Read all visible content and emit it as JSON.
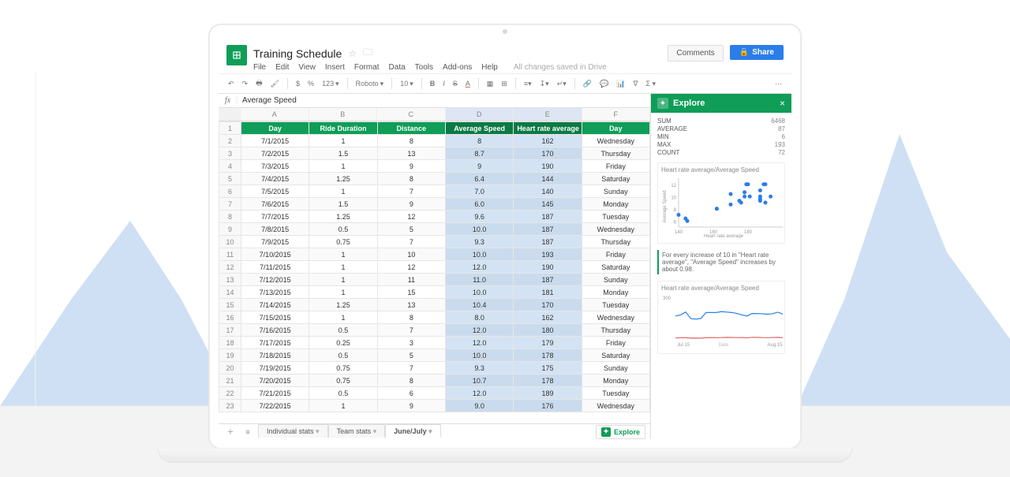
{
  "doc": {
    "title": "Training Schedule",
    "saved_msg": "All changes saved in Drive",
    "comments_label": "Comments",
    "share_label": "Share"
  },
  "menus": [
    "File",
    "Edit",
    "View",
    "Insert",
    "Format",
    "Data",
    "Tools",
    "Add-ons",
    "Help"
  ],
  "toolbar": {
    "zoom": "123",
    "font": "Roboto",
    "size": "10"
  },
  "fx": {
    "value": "Average Speed"
  },
  "columns_letters": [
    "A",
    "B",
    "C",
    "D",
    "E",
    "F"
  ],
  "columns": [
    "Day",
    "Ride Duration",
    "Distance",
    "Average Speed",
    "Heart rate average",
    "Day"
  ],
  "selected_cols": [
    3,
    4
  ],
  "rows": [
    [
      "7/1/2015",
      "1",
      "8",
      "8",
      "162",
      "Wednesday"
    ],
    [
      "7/2/2015",
      "1.5",
      "13",
      "8.7",
      "170",
      "Thursday"
    ],
    [
      "7/3/2015",
      "1",
      "9",
      "9",
      "190",
      "Friday"
    ],
    [
      "7/4/2015",
      "1.25",
      "8",
      "6.4",
      "144",
      "Saturday"
    ],
    [
      "7/5/2015",
      "1",
      "7",
      "7.0",
      "140",
      "Sunday"
    ],
    [
      "7/6/2015",
      "1.5",
      "9",
      "6.0",
      "145",
      "Monday"
    ],
    [
      "7/7/2015",
      "1.25",
      "12",
      "9.6",
      "187",
      "Tuesday"
    ],
    [
      "7/8/2015",
      "0.5",
      "5",
      "10.0",
      "187",
      "Wednesday"
    ],
    [
      "7/9/2015",
      "0.75",
      "7",
      "9.3",
      "187",
      "Thursday"
    ],
    [
      "7/10/2015",
      "1",
      "10",
      "10.0",
      "193",
      "Friday"
    ],
    [
      "7/11/2015",
      "1",
      "12",
      "12.0",
      "190",
      "Saturday"
    ],
    [
      "7/12/2015",
      "1",
      "11",
      "11.0",
      "187",
      "Sunday"
    ],
    [
      "7/13/2015",
      "1",
      "15",
      "10.0",
      "181",
      "Monday"
    ],
    [
      "7/14/2015",
      "1.25",
      "13",
      "10.4",
      "170",
      "Tuesday"
    ],
    [
      "7/15/2015",
      "1",
      "8",
      "8.0",
      "162",
      "Wednesday"
    ],
    [
      "7/16/2015",
      "0.5",
      "7",
      "12.0",
      "180",
      "Thursday"
    ],
    [
      "7/17/2015",
      "0.25",
      "3",
      "12.0",
      "179",
      "Friday"
    ],
    [
      "7/18/2015",
      "0.5",
      "5",
      "10.0",
      "178",
      "Saturday"
    ],
    [
      "7/19/2015",
      "0.75",
      "7",
      "9.3",
      "175",
      "Sunday"
    ],
    [
      "7/20/2015",
      "0.75",
      "8",
      "10.7",
      "178",
      "Monday"
    ],
    [
      "7/21/2015",
      "0.5",
      "6",
      "12.0",
      "189",
      "Tuesday"
    ],
    [
      "7/22/2015",
      "1",
      "9",
      "9.0",
      "176",
      "Wednesday"
    ]
  ],
  "sheet_tabs": {
    "items": [
      "Individual stats",
      "Team stats",
      "June/July"
    ],
    "active": 2,
    "explore_label": "Explore"
  },
  "explore": {
    "title": "Explore",
    "stats": [
      {
        "k": "SUM",
        "v": "6468"
      },
      {
        "k": "AVERAGE",
        "v": "87"
      },
      {
        "k": "MIN",
        "v": "6"
      },
      {
        "k": "MAX",
        "v": "193"
      },
      {
        "k": "COUNT",
        "v": "72"
      }
    ],
    "scatter": {
      "title": "Heart rate average/Average Speed",
      "xlabel": "Heart rate average",
      "ylabel": "Average Speed"
    },
    "insight": "For every increase of 10 in \"Heart rate average\", \"Average Speed\" increases by about 0.98.",
    "lines": {
      "title": "Heart rate average/Average Speed",
      "xlabel": "Date",
      "x_ticks": [
        "Jul 15",
        "Aug 15"
      ]
    }
  },
  "chart_data": [
    {
      "type": "scatter",
      "title": "Heart rate average/Average Speed",
      "xlabel": "Heart rate average",
      "ylabel": "Average Speed",
      "xlim": [
        140,
        200
      ],
      "ylim": [
        5,
        13
      ],
      "x_ticks": [
        140,
        160,
        180
      ],
      "y_ticks": [
        6,
        8,
        10,
        12
      ],
      "x": [
        162,
        170,
        190,
        144,
        140,
        145,
        187,
        187,
        187,
        193,
        190,
        187,
        181,
        170,
        162,
        180,
        179,
        178,
        175,
        178,
        189,
        176
      ],
      "y": [
        8,
        8.7,
        9,
        6.4,
        7.0,
        6.0,
        9.6,
        10.0,
        9.3,
        10.0,
        12.0,
        11.0,
        10.0,
        10.4,
        8.0,
        12.0,
        12.0,
        10.0,
        9.3,
        10.7,
        12.0,
        9.0
      ]
    },
    {
      "type": "line",
      "title": "Heart rate average/Average Speed",
      "xlabel": "Date",
      "categories": [
        "7/1",
        "7/2",
        "7/3",
        "7/4",
        "7/5",
        "7/6",
        "7/7",
        "7/8",
        "7/9",
        "7/10",
        "7/11",
        "7/12",
        "7/13",
        "7/14",
        "7/15",
        "7/16",
        "7/17",
        "7/18",
        "7/19",
        "7/20",
        "7/21",
        "7/22"
      ],
      "series": [
        {
          "name": "Heart rate average",
          "color": "#2b7de9",
          "values": [
            162,
            170,
            190,
            144,
            140,
            145,
            187,
            187,
            187,
            193,
            190,
            187,
            181,
            170,
            162,
            180,
            179,
            178,
            175,
            178,
            189,
            176
          ]
        },
        {
          "name": "Average Speed",
          "color": "#e06666",
          "values": [
            8,
            8.7,
            9,
            6.4,
            7.0,
            6.0,
            9.6,
            10.0,
            9.3,
            10.0,
            12.0,
            11.0,
            10.0,
            10.4,
            8.0,
            12.0,
            12.0,
            10.0,
            9.3,
            10.7,
            12.0,
            9.0
          ]
        }
      ],
      "ylim": [
        0,
        300
      ]
    }
  ]
}
